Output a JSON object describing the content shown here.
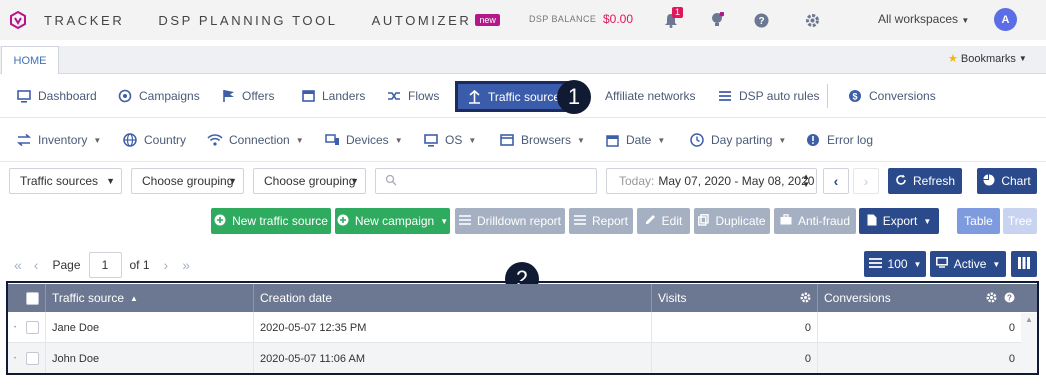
{
  "topbar": {
    "nav": [
      "TRACKER",
      "DSP PLANNING TOOL",
      "AUTOMIZER"
    ],
    "new_badge": "new",
    "balance_label": "DSP BALANCE",
    "balance_value": "$0.00",
    "notifications_count": "1",
    "workspace": "All workspaces",
    "avatar": "A",
    "accent": "#b5178a",
    "alert_color": "#e0185a"
  },
  "tabs": {
    "home": "HOME",
    "bookmarks": "Bookmarks"
  },
  "menu1": [
    {
      "label": "Dashboard",
      "icon": "monitor-icon"
    },
    {
      "label": "Campaigns",
      "icon": "target-icon"
    },
    {
      "label": "Offers",
      "icon": "flag-icon"
    },
    {
      "label": "Landers",
      "icon": "window-icon"
    },
    {
      "label": "Flows",
      "icon": "shuffle-icon"
    },
    {
      "label": "Traffic sources",
      "icon": "traffic-icon",
      "active": true
    },
    {
      "label": "Affiliate networks",
      "icon": "network-icon"
    },
    {
      "label": "DSP auto rules",
      "icon": "list-icon"
    },
    {
      "label": "Conversions",
      "icon": "conversion-icon"
    }
  ],
  "menu2": [
    {
      "label": "Inventory",
      "icon": "swap-icon"
    },
    {
      "label": "Country",
      "icon": "globe-icon"
    },
    {
      "label": "Connection",
      "icon": "wifi-icon"
    },
    {
      "label": "Devices",
      "icon": "devices-icon"
    },
    {
      "label": "OS",
      "icon": "desktop-icon"
    },
    {
      "label": "Browsers",
      "icon": "browser-icon"
    },
    {
      "label": "Date",
      "icon": "calendar-icon"
    },
    {
      "label": "Day parting",
      "icon": "clock-icon"
    },
    {
      "label": "Error log",
      "icon": "error-icon"
    }
  ],
  "callouts": [
    "1",
    "2"
  ],
  "filters": {
    "traffic_sources": "Traffic sources",
    "grouping1": "Choose grouping",
    "grouping2": "Choose grouping",
    "search_placeholder": "",
    "date_prefix": "Today:",
    "date_range": "May 07, 2020 - May 08, 2020",
    "refresh": "Refresh",
    "chart": "Chart"
  },
  "actions": {
    "new_traffic_source": "New traffic source",
    "new_campaign": "New campaign",
    "drilldown": "Drilldown report",
    "report": "Report",
    "edit": "Edit",
    "duplicate": "Duplicate",
    "anti_fraud": "Anti-fraud",
    "export": "Export",
    "table": "Table",
    "tree": "Tree"
  },
  "pager": {
    "page_label": "Page",
    "page": "1",
    "of": "of 1",
    "rows": "100",
    "status": "Active"
  },
  "table": {
    "columns": [
      "Traffic source",
      "Creation date",
      "Visits",
      "Conversions"
    ],
    "rows": [
      {
        "source": "Jane Doe",
        "created": "2020-05-07 12:35 PM",
        "visits": "0",
        "conversions": "0"
      },
      {
        "source": "John Doe",
        "created": "2020-05-07 11:06 AM",
        "visits": "0",
        "conversions": "0"
      }
    ]
  }
}
